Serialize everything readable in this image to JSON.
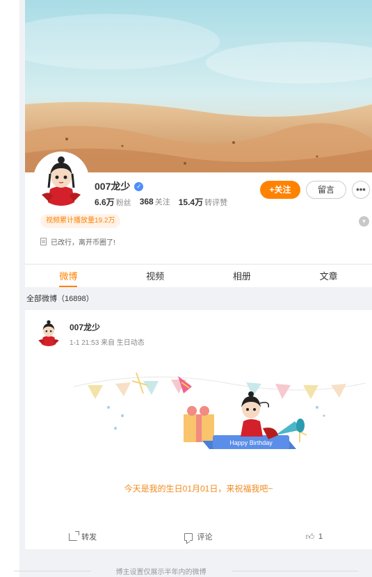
{
  "profile": {
    "username": "007龙少",
    "followers_value": "6.6万",
    "followers_label": "粉丝",
    "following_value": "368",
    "following_label": "关注",
    "reposts_value": "15.4万",
    "reposts_label": "转评赞",
    "follow_label": "+关注",
    "message_label": "留言",
    "more_label": "•••",
    "video_badge": "视频累计播放量19.2万",
    "bio": "已改行，离开币圈了!",
    "verify_icon": "verified-icon",
    "accent_color": "#ff8200"
  },
  "tabs": [
    {
      "label": "微博",
      "active": true
    },
    {
      "label": "视频",
      "active": false
    },
    {
      "label": "相册",
      "active": false
    },
    {
      "label": "文章",
      "active": false
    }
  ],
  "feed": {
    "all_posts_label": "全部微博（16898）"
  },
  "post": {
    "author": "007龙少",
    "meta": "1-1 21:53  来自 生日动态",
    "banner_text": "Happy Birthday",
    "text": "今天是我的生日01月01日，来祝福我吧~",
    "repost_label": "转发",
    "comment_label": "评论",
    "like_count": "1"
  },
  "footer": {
    "note": "博主设置仅展示半年内的微博"
  }
}
